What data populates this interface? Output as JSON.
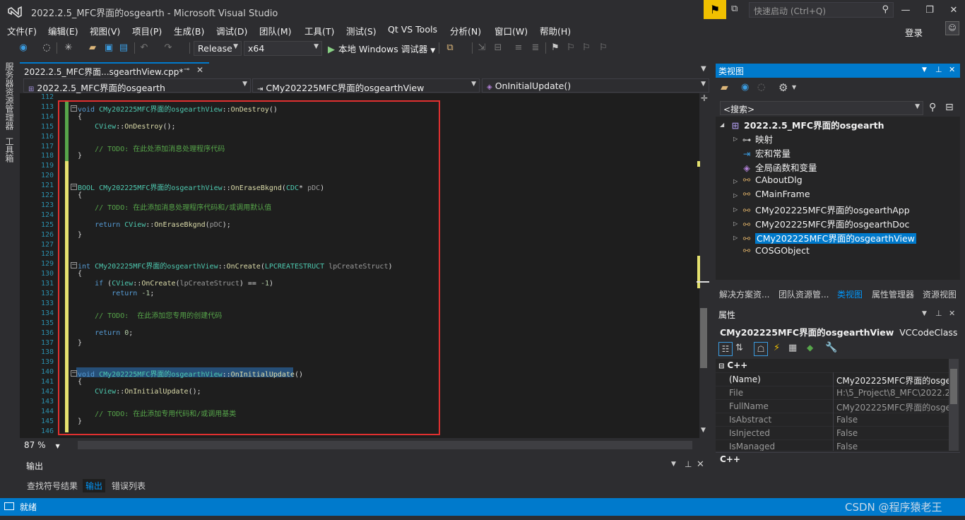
{
  "window": {
    "title": "2022.2.5_MFC界面的osgearth - Microsoft Visual Studio"
  },
  "quick_launch": {
    "placeholder": "快速启动 (Ctrl+Q)"
  },
  "menu": [
    "文件(F)",
    "编辑(E)",
    "视图(V)",
    "项目(P)",
    "生成(B)",
    "调试(D)",
    "团队(M)",
    "工具(T)",
    "测试(S)",
    "Qt VS Tools",
    "分析(N)",
    "窗口(W)",
    "帮助(H)"
  ],
  "account": {
    "login": "登录"
  },
  "toolbar": {
    "config": "Release",
    "platform": "x64",
    "run_label": "本地 Windows 调试器"
  },
  "left_tabs": [
    "服务器资源管理器",
    "工具箱"
  ],
  "editor": {
    "tab_title": "2022.2.5_MFC界面...sgearthView.cpp*",
    "nav_project": "2022.2.5_MFC界面的osgearth",
    "nav_class": "CMy202225MFC界面的osgearthView",
    "nav_member": "OnInitialUpdate()",
    "zoom": "87 %",
    "lines": [
      {
        "n": "112",
        "t": ""
      },
      {
        "n": "113",
        "t": "void CMy202225MFC界面的osgearthView::OnDestroy()"
      },
      {
        "n": "114",
        "t": "{"
      },
      {
        "n": "115",
        "t": "    CView::OnDestroy();"
      },
      {
        "n": "116",
        "t": ""
      },
      {
        "n": "117",
        "t": "    // TODO: 在此处添加消息处理程序代码"
      },
      {
        "n": "118",
        "t": "}"
      },
      {
        "n": "119",
        "t": ""
      },
      {
        "n": "120",
        "t": ""
      },
      {
        "n": "121",
        "t": "BOOL CMy202225MFC界面的osgearthView::OnEraseBkgnd(CDC* pDC)"
      },
      {
        "n": "122",
        "t": "{"
      },
      {
        "n": "123",
        "t": "    // TODO: 在此添加消息处理程序代码和/或调用默认值"
      },
      {
        "n": "124",
        "t": ""
      },
      {
        "n": "125",
        "t": "    return CView::OnEraseBkgnd(pDC);"
      },
      {
        "n": "126",
        "t": "}"
      },
      {
        "n": "127",
        "t": ""
      },
      {
        "n": "128",
        "t": ""
      },
      {
        "n": "129",
        "t": "int CMy202225MFC界面的osgearthView::OnCreate(LPCREATESTRUCT lpCreateStruct)"
      },
      {
        "n": "130",
        "t": "{"
      },
      {
        "n": "131",
        "t": "    if (CView::OnCreate(lpCreateStruct) == -1)"
      },
      {
        "n": "132",
        "t": "        return -1;"
      },
      {
        "n": "133",
        "t": ""
      },
      {
        "n": "134",
        "t": "    // TODO:  在此添加您专用的创建代码"
      },
      {
        "n": "135",
        "t": ""
      },
      {
        "n": "136",
        "t": "    return 0;"
      },
      {
        "n": "137",
        "t": "}"
      },
      {
        "n": "138",
        "t": ""
      },
      {
        "n": "139",
        "t": ""
      },
      {
        "n": "140",
        "t": "void CMy202225MFC界面的osgearthView::OnInitialUpdate()"
      },
      {
        "n": "141",
        "t": "{"
      },
      {
        "n": "142",
        "t": "    CView::OnInitialUpdate();"
      },
      {
        "n": "143",
        "t": ""
      },
      {
        "n": "144",
        "t": "    // TODO: 在此添加专用代码和/或调用基类"
      },
      {
        "n": "145",
        "t": "}"
      },
      {
        "n": "146",
        "t": ""
      }
    ]
  },
  "output": {
    "title": "输出",
    "tabs": [
      "查找符号结果",
      "输出",
      "错误列表"
    ],
    "active_tab": "输出"
  },
  "class_view": {
    "title": "类视图",
    "search_placeholder": "<搜索>",
    "root": "2022.2.5_MFC界面的osgearth",
    "items": [
      "映射",
      "宏和常量",
      "全局函数和变量",
      "CAboutDlg",
      "CMainFrame",
      "CMy202225MFC界面的osgearthApp",
      "CMy202225MFC界面的osgearthDoc",
      "CMy202225MFC界面的osgearthView",
      "COSGObject"
    ],
    "selected": "CMy202225MFC界面的osgearthView"
  },
  "bottom_tabs": [
    "解决方案资...",
    "团队资源管...",
    "类视图",
    "属性管理器",
    "资源视图"
  ],
  "bottom_active": "类视图",
  "properties": {
    "title": "属性",
    "object_name": "CMy202225MFC界面的osgearthView",
    "object_type": "VCCodeClass",
    "category": "C++",
    "rows": [
      {
        "k": "(Name)",
        "v": "CMy202225MFC界面的osge"
      },
      {
        "k": "File",
        "v": "H:\\5_Project\\8_MFC\\2022.2."
      },
      {
        "k": "FullName",
        "v": "CMy202225MFC界面的osge"
      },
      {
        "k": "IsAbstract",
        "v": "False"
      },
      {
        "k": "IsInjected",
        "v": "False"
      },
      {
        "k": "IsManaged",
        "v": "False"
      }
    ],
    "desc": "C++"
  },
  "status": {
    "text": "就绪",
    "color": "#007acc"
  },
  "watermark": "CSDN @程序猿老王"
}
